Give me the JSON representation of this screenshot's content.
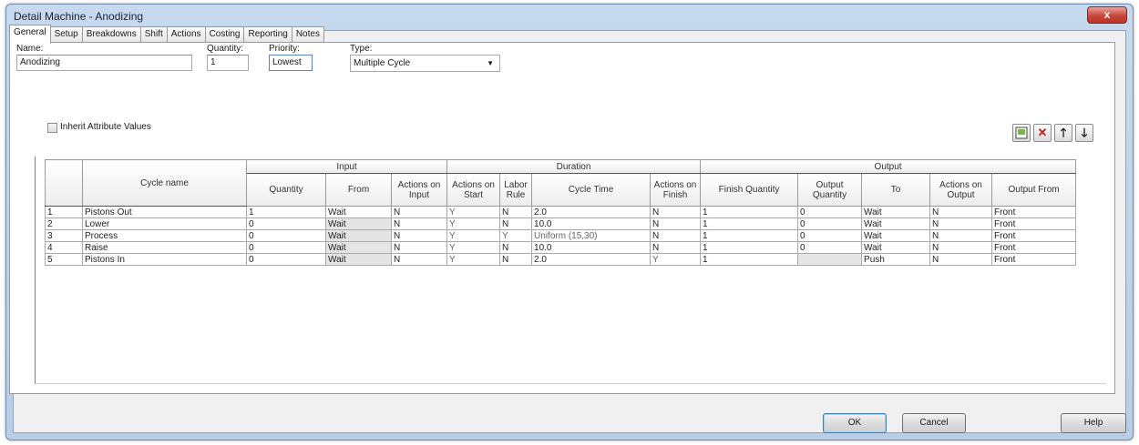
{
  "window": {
    "title": "Detail Machine - Anodizing",
    "close_glyph": "x"
  },
  "tabs": [
    "General",
    "Setup",
    "Breakdowns",
    "Shift",
    "Actions",
    "Costing",
    "Reporting",
    "Notes"
  ],
  "form": {
    "name_label": "Name:",
    "name_value": "Anodizing",
    "quantity_label": "Quantity:",
    "quantity_value": "1",
    "priority_label": "Priority:",
    "priority_value": "Lowest",
    "type_label": "Type:",
    "type_value": "Multiple Cycle",
    "inherit_label": "Inherit Attribute Values"
  },
  "toolbar": {
    "add_icon": "new-row-icon",
    "delete_icon": "delete-icon",
    "up_icon": "move-up-icon",
    "down_icon": "move-down-icon"
  },
  "grid": {
    "groups": {
      "input": "Input",
      "duration": "Duration",
      "output": "Output"
    },
    "columns": {
      "cycle_name": "Cycle name",
      "quantity": "Quantity",
      "from": "From",
      "actions_on_input": "Actions on Input",
      "actions_on_start": "Actions on Start",
      "labor_rule": "Labor Rule",
      "cycle_time": "Cycle Time",
      "actions_on_finish": "Actions on Finish",
      "finish_quantity": "Finish Quantity",
      "output_quantity": "Output Quantity",
      "to": "To",
      "actions_on_output": "Actions on Output",
      "output_from": "Output From"
    },
    "rows": [
      [
        "1",
        "Pistons Out",
        "1",
        "Wait",
        "N",
        "Y",
        "N",
        "2.0",
        "N",
        "1",
        "0",
        "Wait",
        "N",
        "Front"
      ],
      [
        "2",
        "Lower",
        "0",
        "Wait",
        "N",
        "Y",
        "N",
        "10.0",
        "N",
        "1",
        "0",
        "Wait",
        "N",
        "Front"
      ],
      [
        "3",
        "Process",
        "0",
        "Wait",
        "N",
        "Y",
        "Y",
        "Uniform (15,30)",
        "N",
        "1",
        "0",
        "Wait",
        "N",
        "Front"
      ],
      [
        "4",
        "Raise",
        "0",
        "Wait",
        "N",
        "Y",
        "N",
        "10.0",
        "N",
        "1",
        "0",
        "Wait",
        "N",
        "Front"
      ],
      [
        "5",
        "Pistons In",
        "0",
        "Wait",
        "N",
        "Y",
        "N",
        "2.0",
        "Y",
        "1",
        "",
        "Push",
        "N",
        "Front"
      ]
    ]
  },
  "buttons": {
    "ok": "OK",
    "cancel": "Cancel",
    "help": "Help"
  }
}
